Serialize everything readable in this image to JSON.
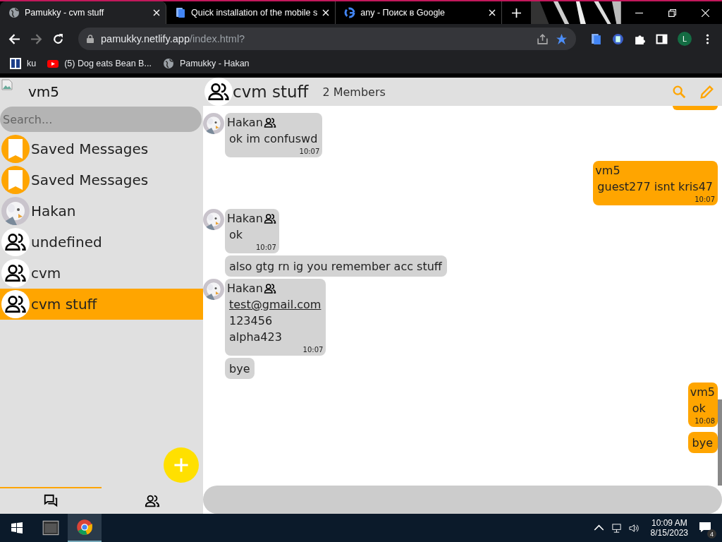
{
  "browser": {
    "tabs": [
      {
        "title": "Pamukky - cvm stuff",
        "selected": true
      },
      {
        "title": "Quick installation of the mobile s",
        "selected": false
      },
      {
        "title": "any - Поиск в Google",
        "selected": false
      }
    ],
    "url_host": "pamukky.netlify.app",
    "url_path": "/index.html?",
    "profile": "L",
    "bookmarks": [
      {
        "title": "ku"
      },
      {
        "title": "(5) Dog eats Bean B..."
      },
      {
        "title": "Pamukky - Hakan"
      }
    ]
  },
  "sidebar": {
    "user": "vm5",
    "search": {
      "placeholder": "Search..."
    },
    "chats": [
      {
        "name": "Saved Messages",
        "kind": "saved",
        "selected": false
      },
      {
        "name": "Saved Messages",
        "kind": "saved",
        "selected": false
      },
      {
        "name": "Hakan",
        "kind": "person",
        "selected": false
      },
      {
        "name": "undefined",
        "kind": "group",
        "selected": false
      },
      {
        "name": "cvm",
        "kind": "group",
        "selected": false
      },
      {
        "name": "cvm stuff",
        "kind": "group",
        "selected": true
      }
    ],
    "nav": [
      {
        "kind": "chats",
        "selected": true
      },
      {
        "kind": "contacts",
        "selected": false
      }
    ]
  },
  "chat": {
    "title": "cvm stuff",
    "members": "2 Members",
    "messages": [
      {
        "kind": "incoming",
        "sender": "Hakan",
        "lines": [
          {
            "text": "ok im confuswd"
          }
        ],
        "time": "10:07"
      },
      {
        "kind": "outgoing",
        "sender": "vm5",
        "lines": [
          {
            "text": "guest277 isnt kris47"
          }
        ],
        "time": "10:07"
      },
      {
        "kind": "incoming",
        "sender": "Hakan",
        "lines": [
          {
            "text": "ok"
          }
        ],
        "time": "10:07"
      },
      {
        "kind": "incoming",
        "lines": [
          {
            "text": "also gtg rn ig you remember acc stuff"
          }
        ]
      },
      {
        "kind": "incoming",
        "sender": "Hakan",
        "lines": [
          {
            "text": "test@gmail.com",
            "link": true
          },
          {
            "text": "123456"
          },
          {
            "text": "alpha423"
          }
        ],
        "time": "10:07"
      },
      {
        "kind": "incoming",
        "lines": [
          {
            "text": "bye"
          }
        ]
      },
      {
        "kind": "outgoing",
        "sender": "vm5",
        "lines": [
          {
            "text": "ok"
          }
        ],
        "time": "10:08"
      },
      {
        "kind": "outgoing",
        "lines": [
          {
            "text": "bye"
          }
        ]
      }
    ]
  },
  "taskbar": {
    "time": "10:09 AM",
    "date": "8/15/2023",
    "notifications": "4"
  }
}
